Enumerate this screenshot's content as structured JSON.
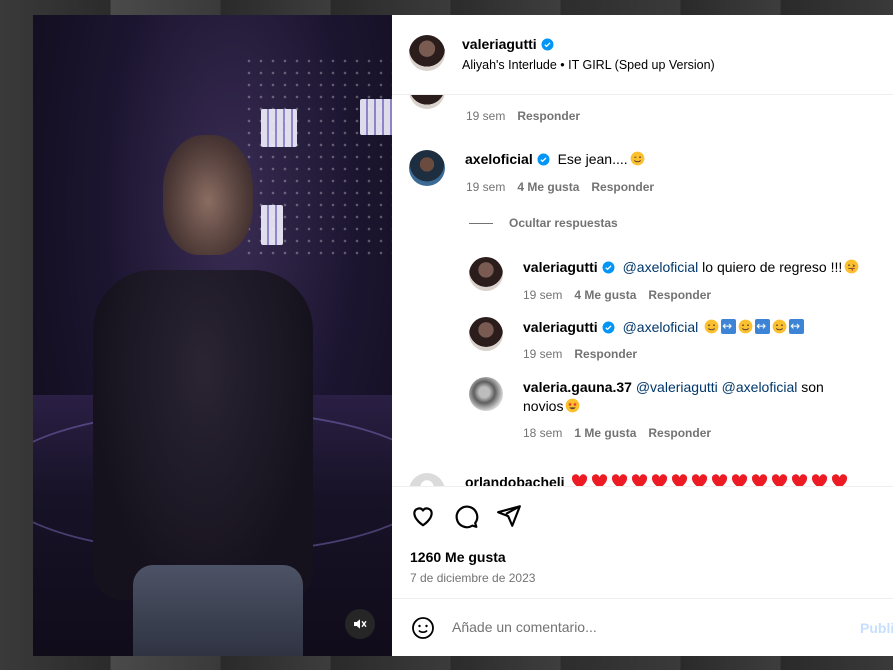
{
  "post": {
    "username": "valeriagutti",
    "audio": "Aliyah's Interlude • IT GIRL (Sped up Version)"
  },
  "comments": {
    "partial": {
      "time": "19 sem",
      "reply": "Responder"
    },
    "axel": {
      "username": "axeloficial",
      "text": "Ese jean....",
      "time": "19 sem",
      "likes": "4 Me gusta",
      "reply": "Responder"
    },
    "hide_replies": "Ocultar respuestas",
    "replies": [
      {
        "username": "valeriagutti",
        "mention": "@axeloficial",
        "text": "lo quiero de regreso !!!",
        "time": "19 sem",
        "likes": "4 Me gusta",
        "reply": "Responder"
      },
      {
        "username": "valeriagutti",
        "mention": "@axeloficial",
        "time": "19 sem",
        "reply": "Responder"
      },
      {
        "username": "valeria.gauna.37",
        "mention1": "@valeriagutti",
        "mention2": "@axeloficial",
        "text": "son",
        "text2": "novios",
        "time": "18 sem",
        "likes": "1 Me gusta",
        "reply": "Responder"
      }
    ],
    "orlando": {
      "username": "orlandobacheli"
    }
  },
  "actions": {
    "likes": "1260 Me gusta",
    "date": "7 de diciembre de 2023"
  },
  "composer": {
    "placeholder": "Añade un comentario...",
    "publish": "Publi"
  },
  "colors": {
    "verified": "#0095f6",
    "heart": "#ed1c24",
    "mention": "#00376b",
    "muted": "#737373"
  }
}
